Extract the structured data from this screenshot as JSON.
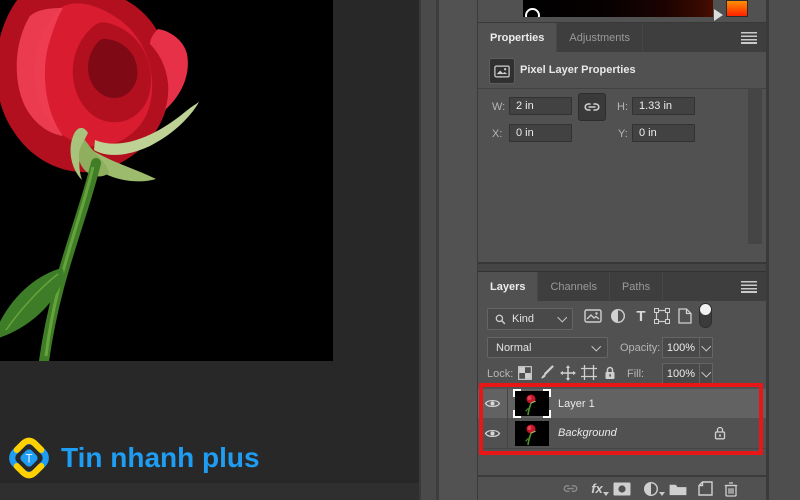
{
  "brand": {
    "name": "Tin nhanh plus"
  },
  "colors": {
    "annotation_red": "#e81717",
    "logo_blue": "#1e9df2",
    "logo_yellow": "#ffd100",
    "swatch_top": "#ff9000",
    "swatch_bottom": "#ff2000",
    "panel_bg": "#515151",
    "workspace_bg": "#282828"
  },
  "properties_panel": {
    "tabs": {
      "properties": "Properties",
      "adjustments": "Adjustments"
    },
    "header_title": "Pixel Layer Properties",
    "fields": {
      "w_label": "W:",
      "w_value": "2 in",
      "h_label": "H:",
      "h_value": "1.33 in",
      "x_label": "X:",
      "x_value": "0 in",
      "y_label": "Y:",
      "y_value": "0 in"
    }
  },
  "layers_panel": {
    "tabs": {
      "layers": "Layers",
      "channels": "Channels",
      "paths": "Paths"
    },
    "filter": {
      "kind": "Kind",
      "type_glyph": "T"
    },
    "blend": {
      "mode": "Normal",
      "opacity_label": "Opacity:",
      "opacity_value": "100%"
    },
    "lock": {
      "label": "Lock:",
      "fill_label": "Fill:",
      "fill_value": "100%"
    },
    "rows": [
      {
        "name": "Layer 1",
        "selected": true
      },
      {
        "name": "Background",
        "selected": false
      }
    ],
    "footer": {
      "fx": "fx"
    }
  }
}
